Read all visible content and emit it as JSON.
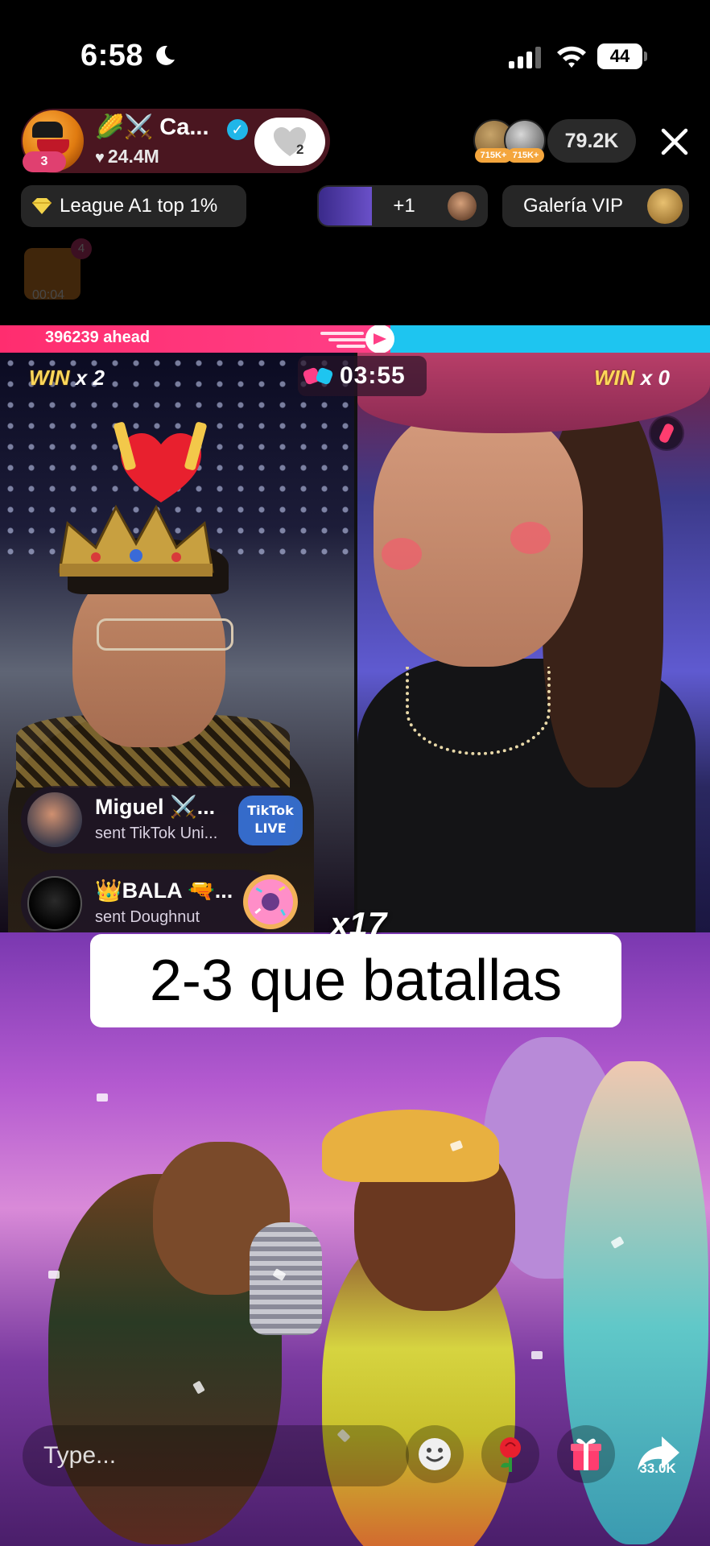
{
  "status_bar": {
    "time": "6:58",
    "battery": "44",
    "icons": [
      "moon-icon",
      "signal-icon",
      "wifi-icon",
      "battery-icon"
    ]
  },
  "host": {
    "name": "🌽⚔️ Ca...",
    "likes": "24.4M",
    "level_badge": "3",
    "follow_count": "2"
  },
  "viewers": {
    "tags": [
      "715K+",
      "715K+"
    ],
    "count": "79.2K"
  },
  "chips": {
    "league": "League A1 top 1%",
    "rank_change": "+1",
    "vip": "Galería VIP"
  },
  "faded_gift": {
    "badge": "4",
    "timer": "00:04"
  },
  "battle": {
    "ahead_text": "396239 ahead",
    "timer": "03:55",
    "left_win": {
      "label": "WIN",
      "count": "x 2"
    },
    "right_win": {
      "label": "WIN",
      "count": "x 0"
    },
    "score_share_left": 0.55
  },
  "gifts": [
    {
      "user": "Miguel ⚔️...",
      "action": "sent TikTok Uni...",
      "icon": "tiktok-live-icon"
    },
    {
      "user": "👑BALA 🔫...",
      "action": "sent Doughnut",
      "icon": "donut-icon"
    }
  ],
  "multiplier": "x17",
  "caption": "2-3 que batallas",
  "bottom": {
    "input_placeholder": "Type...",
    "share_count": "33.0K",
    "icons": [
      "emoji-icon",
      "rose-icon",
      "gift-icon",
      "share-icon"
    ]
  },
  "colors": {
    "team_left": "#ff3f87",
    "team_right": "#1ec5f0",
    "win_label": "#ffd75a"
  }
}
